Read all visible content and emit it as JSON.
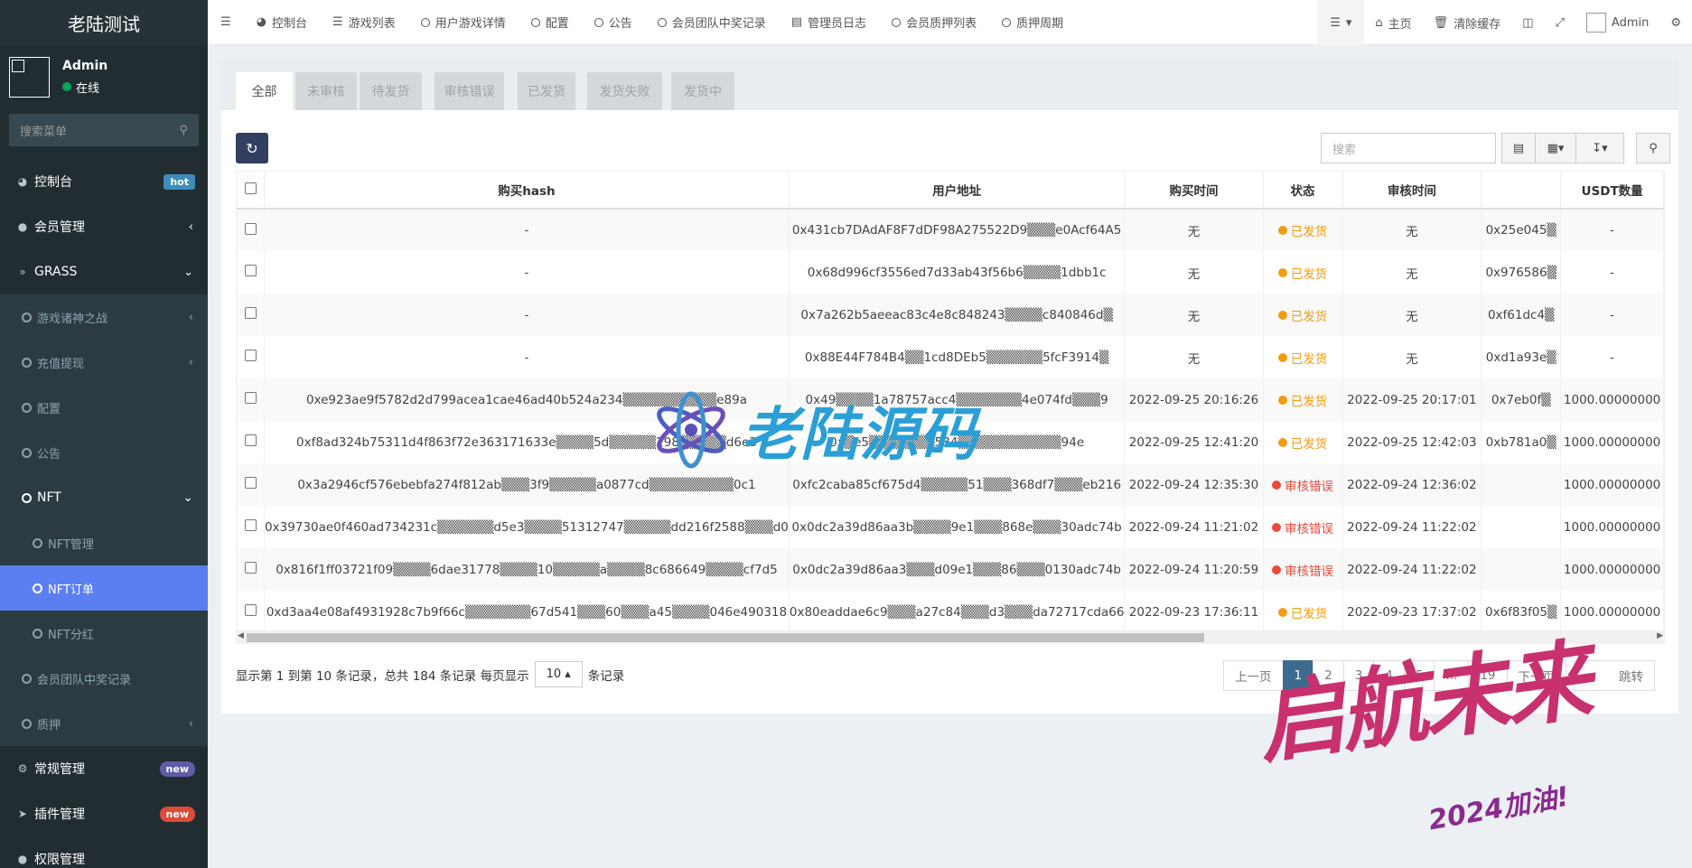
{
  "sidebar": {
    "logo": "老陆测试",
    "user": {
      "name": "Admin",
      "status": "在线"
    },
    "search_placeholder": "搜索菜单",
    "items": [
      {
        "label": "控制台",
        "badge": "hot"
      },
      {
        "label": "会员管理"
      },
      {
        "label": "GRASS"
      },
      {
        "label": "游戏诸神之战"
      },
      {
        "label": "充值提现"
      },
      {
        "label": "配置"
      },
      {
        "label": "公告"
      },
      {
        "label": "NFT"
      },
      {
        "label": "NFT管理"
      },
      {
        "label": "NFT订单"
      },
      {
        "label": "NFT分红"
      },
      {
        "label": "会员团队中奖记录"
      },
      {
        "label": "质押"
      },
      {
        "label": "常规管理",
        "badge": "new"
      },
      {
        "label": "插件管理",
        "badge": "new"
      },
      {
        "label": "权限管理"
      }
    ]
  },
  "topnav": {
    "tabs": [
      "控制台",
      "游戏列表",
      "用户游戏详情",
      "配置",
      "公告",
      "会员团队中奖记录",
      "管理员日志",
      "会员质押列表",
      "质押周期"
    ],
    "home": "主页",
    "clear_cache": "清除缓存",
    "admin": "Admin"
  },
  "filter_tabs": [
    "全部",
    "未审核",
    "待发货",
    "审核错误",
    "已发货",
    "发货失败",
    "发货中"
  ],
  "toolbar": {
    "search_placeholder": "搜索"
  },
  "table": {
    "columns": [
      "购买hash",
      "用户地址",
      "购买时间",
      "状态",
      "审核时间",
      "",
      "USDT数量"
    ],
    "rows": [
      [
        "-",
        "0x431cb7DAdAF8F7dDF98A275522D9▒▒▒e0Acf64A5",
        "无",
        "已发货",
        "无",
        "0x25e045▒",
        "-"
      ],
      [
        "-",
        "0x68d996cf3556ed7d33ab43f56b6▒▒▒▒1dbb1c",
        "无",
        "已发货",
        "无",
        "0x976586▒",
        "-"
      ],
      [
        "-",
        "0x7a262b5aeeac83c4e8c848243▒▒▒▒c840846d▒",
        "无",
        "已发货",
        "无",
        "0xf61dc4▒",
        "-"
      ],
      [
        "-",
        "0x88E44F784B4▒▒1cd8DEb5▒▒▒▒▒▒5fcF3914▒",
        "无",
        "已发货",
        "无",
        "0xd1a93e▒",
        "-"
      ],
      [
        "0xe923ae9f5782d2d799acea1cae46ad40b524a234▒▒▒▒▒▒▒▒▒▒e89a",
        "0x49▒▒▒▒1a78757acc4▒▒▒▒▒▒▒4e074fd▒▒▒9",
        "2022-09-25 20:16:26",
        "已发货",
        "2022-09-25 20:17:01",
        "0x7eb0f▒",
        "1000.00000000"
      ],
      [
        "0xf8ad324b75311d4f863f72e363171633e▒▒▒▒5d▒▒▒▒▒298▒▒▒▒▒d6e3",
        "0x▒e5▒▒▒▒▒▒▒534▒▒▒▒▒▒▒▒▒▒▒94e",
        "2022-09-25 12:41:20",
        "已发货",
        "2022-09-25 12:42:03",
        "0xb781a0▒",
        "1000.00000000"
      ],
      [
        "0x3a2946cf576ebebfa274f812ab▒▒▒3f9▒▒▒▒▒a0877cd▒▒▒▒▒▒▒▒▒0c1",
        "0xfc2caba85cf675d4▒▒▒▒▒51▒▒▒368df7▒▒▒eb216",
        "2022-09-24 12:35:30",
        "审核错误",
        "2022-09-24 12:36:02",
        "",
        "1000.00000000"
      ],
      [
        "0x39730ae0f460ad734231c▒▒▒▒▒▒d5e3▒▒▒▒51312747▒▒▒▒▒dd216f2588▒▒▒d0",
        "0x0dc2a39d86aa3b▒▒▒▒9e1▒▒▒868e▒▒▒30adc74b",
        "2022-09-24 11:21:02",
        "审核错误",
        "2022-09-24 11:22:02",
        "",
        "1000.00000000"
      ],
      [
        "0x816f1ff03721f09▒▒▒▒6dae31778▒▒▒▒10▒▒▒▒▒a▒▒▒▒8c686649▒▒▒▒cf7d5",
        "0x0dc2a39d86aa3▒▒▒d09e1▒▒▒86▒▒▒0130adc74b",
        "2022-09-24 11:20:59",
        "审核错误",
        "2022-09-24 11:22:02",
        "",
        "1000.00000000"
      ],
      [
        "0xd3aa4e08af4931928c7b9f66c▒▒▒▒▒▒▒67d541▒▒▒60▒▒▒a45▒▒▒▒046e490318",
        "0x80eaddae6c9▒▒▒a27c84▒▒▒d3▒▒▒da72717cda66",
        "2022-09-23 17:36:11",
        "已发货",
        "2022-09-23 17:37:02",
        "0x6f83f05▒",
        "1000.00000000"
      ]
    ]
  },
  "status_colors": {
    "已发货": "#f39c12",
    "审核错误": "#e74c3c"
  },
  "pagination": {
    "summary_prefix": "显示第 1 到第 10 条记录，总共 184 条记录 每页显示",
    "page_size": "10",
    "summary_suffix": "条记录",
    "prev": "上一页",
    "pages": [
      "1",
      "2",
      "3",
      "4",
      "5",
      "...",
      "19"
    ],
    "next": "下一页",
    "jump": "跳转"
  },
  "watermarks": {
    "brand": "老陆源码",
    "slogan": "启航未来",
    "year": "2024加油!"
  }
}
